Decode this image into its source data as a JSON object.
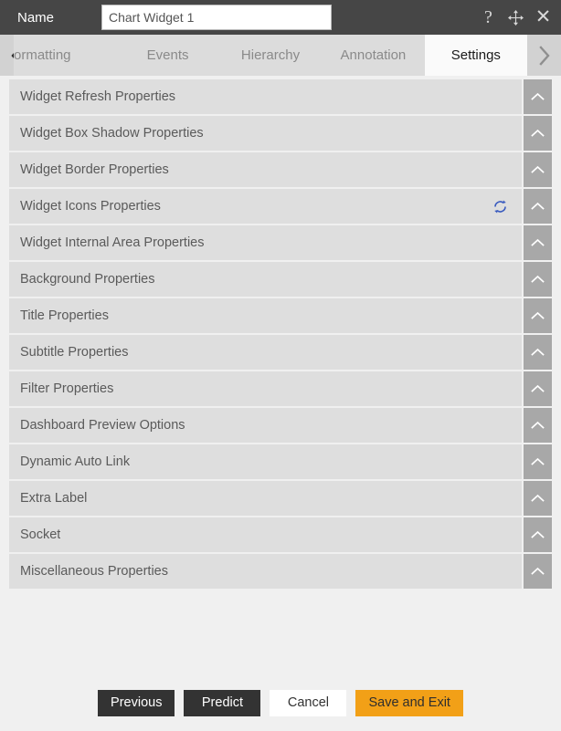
{
  "titlebar": {
    "name_label": "Name",
    "name_value": "Chart Widget 1",
    "name_placeholder": "Name",
    "help_glyph": "?",
    "close_glyph": "✕",
    "bg_color": "#464646"
  },
  "tabstrip": {
    "prev_arrow_name": "chevron-left-icon",
    "next_arrow_name": "chevron-right-icon",
    "tabs": [
      {
        "label": "ormatting",
        "active": false
      },
      {
        "label": "Events",
        "active": false
      },
      {
        "label": "Hierarchy",
        "active": false
      },
      {
        "label": "Annotation",
        "active": false
      },
      {
        "label": "Settings",
        "active": true
      }
    ]
  },
  "panel": {
    "sections": [
      {
        "label": "Widget Refresh Properties",
        "has_refresh_icon": false
      },
      {
        "label": "Widget Box Shadow Properties",
        "has_refresh_icon": false
      },
      {
        "label": "Widget Border Properties",
        "has_refresh_icon": false
      },
      {
        "label": "Widget Icons Properties",
        "has_refresh_icon": true
      },
      {
        "label": "Widget Internal Area Properties",
        "has_refresh_icon": false
      },
      {
        "label": "Background Properties",
        "has_refresh_icon": false
      },
      {
        "label": "Title Properties",
        "has_refresh_icon": false
      },
      {
        "label": "Subtitle Properties",
        "has_refresh_icon": false
      },
      {
        "label": "Filter Properties",
        "has_refresh_icon": false
      },
      {
        "label": "Dashboard Preview Options",
        "has_refresh_icon": false
      },
      {
        "label": "Dynamic Auto Link",
        "has_refresh_icon": false
      },
      {
        "label": "Extra Label",
        "has_refresh_icon": false
      },
      {
        "label": "Socket",
        "has_refresh_icon": false
      },
      {
        "label": "Miscellaneous Properties",
        "has_refresh_icon": false
      }
    ]
  },
  "footer": {
    "buttons": [
      {
        "label": "Previous",
        "style": "dark"
      },
      {
        "label": "Predict",
        "style": "dark"
      },
      {
        "label": "Cancel",
        "style": "light"
      },
      {
        "label": "Save and Exit",
        "style": "accent"
      }
    ]
  },
  "colors": {
    "titlebar": "#464646",
    "tabstrip": "#dcdcdc",
    "tab_active": "#fafafa",
    "row": "#dedede",
    "toggle": "#a8a8a8",
    "page_bg": "#f0f0f0",
    "accent": "#f2a017",
    "refresh_icon": "#3a5bbf"
  }
}
